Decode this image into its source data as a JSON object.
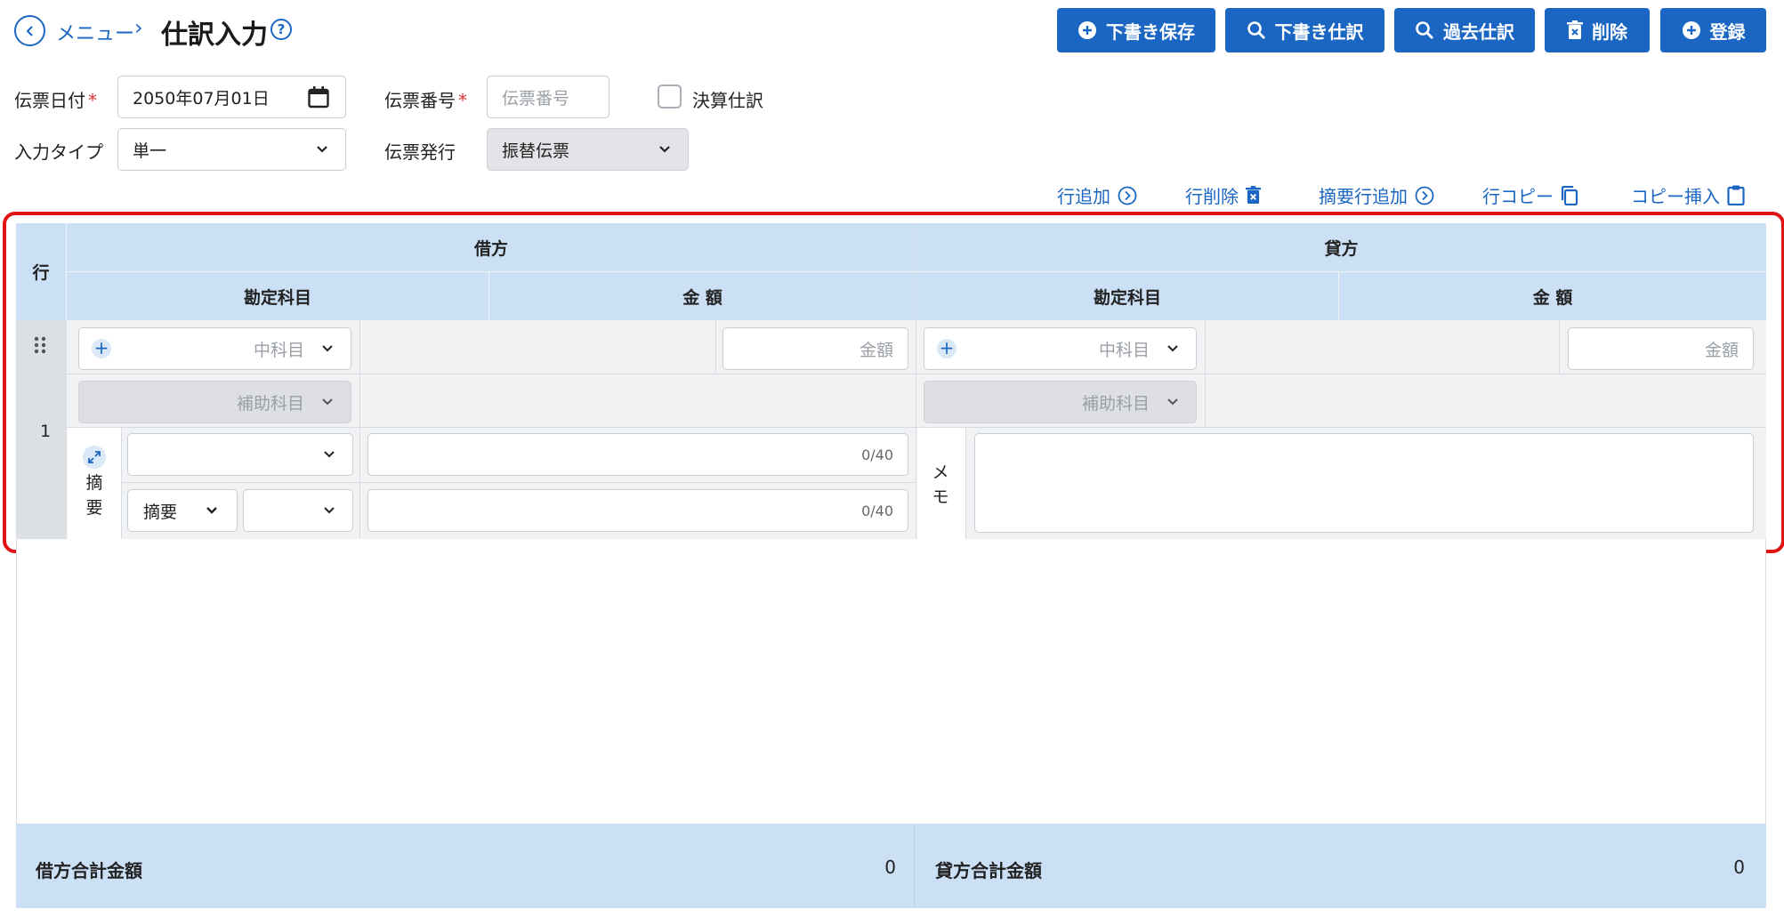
{
  "header": {
    "breadcrumb": "メニュー",
    "separator": "›",
    "title": "仕訳入力",
    "help": "?"
  },
  "toolbar": {
    "draft_save": "下書き保存",
    "draft_entry": "下書き仕訳",
    "past_entry": "過去仕訳",
    "delete": "削除",
    "register": "登録"
  },
  "form": {
    "date_label": "伝票日付",
    "required_mark": "*",
    "date_value": "2050年07月01日",
    "number_label": "伝票番号",
    "number_placeholder": "伝票番号",
    "closing_label": "決算仕訳",
    "input_type_label": "入力タイプ",
    "input_type_value": "単一",
    "issue_label": "伝票発行",
    "issue_value": "振替伝票"
  },
  "row_actions": {
    "add_row": "行追加",
    "delete_row": "行削除",
    "add_summary_row": "摘要行追加",
    "copy_row": "行コピー",
    "copy_insert": "コピー挿入"
  },
  "grid": {
    "row_header": "行",
    "debit_header": "借方",
    "credit_header": "貸方",
    "account_header": "勘定科目",
    "amount_header": "金 額",
    "row_number": "1",
    "account_placeholder": "中科目",
    "sub_account_placeholder": "補助科目",
    "amount_placeholder": "金額",
    "summary_label_1": "摘",
    "summary_label_2": "要",
    "summary_select": "摘要",
    "counter_1": "0/40",
    "counter_2": "0/40",
    "memo_label_1": "メ",
    "memo_label_2": "モ"
  },
  "totals": {
    "debit_label": "借方合計金額",
    "debit_value": "0",
    "credit_label": "貸方合計金額",
    "credit_value": "0"
  },
  "colors": {
    "primary": "#1a66c2",
    "header_bg": "#cbdff5",
    "highlight": "#e01414"
  }
}
